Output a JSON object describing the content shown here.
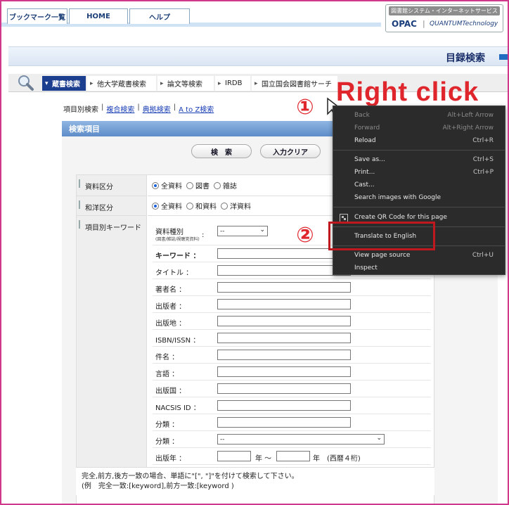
{
  "header": {
    "tabs": [
      {
        "label": "ブックマーク一覧"
      },
      {
        "label": "HOME"
      },
      {
        "label": "ヘルプ"
      }
    ],
    "brand": {
      "tagline": "図書館システム・インターネットサービス",
      "opac": "OPAC",
      "separator": "|",
      "vendor": "QUANTUMTechnology"
    }
  },
  "title_band": {
    "title": "目録検索"
  },
  "search_tabs": [
    {
      "label": "蔵書検索",
      "active": true
    },
    {
      "label": "他大学蔵書検索"
    },
    {
      "label": "論文等検索"
    },
    {
      "label": "IRDB"
    },
    {
      "label": "国立国会図書館サーチ"
    }
  ],
  "sub_links": {
    "current": "項目別検索",
    "links": [
      "複合検索",
      "典拠検索",
      "A to Z検索"
    ],
    "separator": "|"
  },
  "panel": {
    "title": "検索項目",
    "search_button": "検　索",
    "clear_button": "入力クリア"
  },
  "form": {
    "material_type": {
      "label": "資料区分",
      "options": [
        {
          "label": "全資料",
          "checked": true
        },
        {
          "label": "図書",
          "checked": false
        },
        {
          "label": "雑誌",
          "checked": false
        }
      ]
    },
    "language_type": {
      "label": "和洋区分",
      "options": [
        {
          "label": "全資料",
          "checked": true
        },
        {
          "label": "和資料",
          "checked": false
        },
        {
          "label": "洋資料",
          "checked": false
        }
      ]
    },
    "keyword_section": {
      "label": "項目別キーワード",
      "kind_label": "資料種別",
      "kind_sublabel": "(図書/雑誌/視聴覚資料)",
      "kind_colon": ":",
      "kind_value": "--",
      "fields": [
        {
          "label": "キーワード ："
        },
        {
          "label": "タイトル ："
        },
        {
          "label": "著者名 ："
        },
        {
          "label": "出版者 ："
        },
        {
          "label": "出版地 ："
        },
        {
          "label": "ISBN/ISSN ："
        },
        {
          "label": "件名 ："
        },
        {
          "label": "言語 ："
        },
        {
          "label": "出版国 ："
        },
        {
          "label": "NACSIS ID ："
        },
        {
          "label": "分類 ："
        }
      ],
      "class_select_label": "分類 ：",
      "class_select_value": "--",
      "year_label": "出版年 ：",
      "year_unit_from": "年 ～",
      "year_unit_to": "年",
      "year_note": "(西暦４桁)"
    },
    "note_line1": "完全,前方,後方一致の場合、単語に\"[\", \"]\"を付けて検索して下さい。",
    "note_line2": "(例　完全一致:[keyword],前方一致:[keyword )"
  },
  "context_menu": {
    "items": [
      {
        "label": "Back",
        "shortcut": "Alt+Left Arrow",
        "disabled": true
      },
      {
        "label": "Forward",
        "shortcut": "Alt+Right Arrow",
        "disabled": true
      },
      {
        "label": "Reload",
        "shortcut": "Ctrl+R"
      },
      {
        "label": "Save as...",
        "shortcut": "Ctrl+S"
      },
      {
        "label": "Print...",
        "shortcut": "Ctrl+P"
      },
      {
        "label": "Cast..."
      },
      {
        "label": "Search images with Google"
      },
      {
        "label": "Create QR Code for this page"
      },
      {
        "label": "Translate to English"
      },
      {
        "label": "View page source",
        "shortcut": "Ctrl+U"
      },
      {
        "label": "Inspect"
      }
    ]
  },
  "annotations": {
    "step1": "①",
    "step2": "②",
    "right_click": "Right click",
    "color": "#e0262d"
  }
}
